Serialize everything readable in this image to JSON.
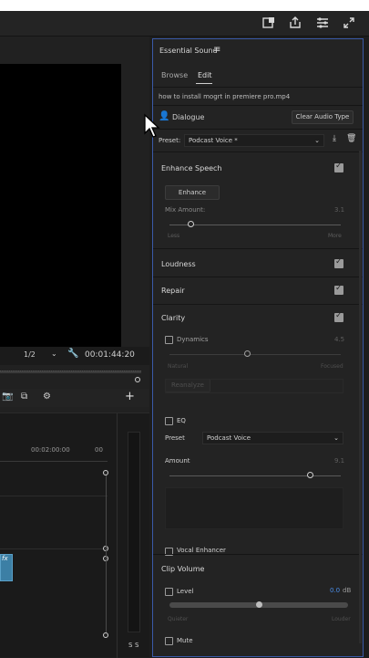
{
  "essential_sound": {
    "title": "Essential Sound",
    "menu_icon": "hamburger-icon",
    "tabs": [
      {
        "label": "Browse"
      },
      {
        "label": "Edit"
      }
    ],
    "clip_name": "how to install mogrt in premiere pro.mp4",
    "audio_type": "Dialogue",
    "clear_label": "Clear Audio Type",
    "preset_label": "Preset:",
    "preset_value": "Podcast Voice *",
    "enhance_speech": {
      "title": "Enhance Speech",
      "button": "Enhance",
      "mix_label": "Mix Amount:",
      "mix_value": "3.1",
      "left": "Less",
      "right": "More",
      "mix_level": 0.12
    },
    "loudness": {
      "title": "Loudness"
    },
    "repair": {
      "title": "Repair"
    },
    "clarity": {
      "title": "Clarity",
      "dynamics": {
        "label": "Dynamics",
        "value": "4.5",
        "left": "Natural",
        "right": "Focused",
        "button": "Reanalyze",
        "level": 0.45
      },
      "eq": {
        "label": "EQ",
        "preset_label": "Preset",
        "preset_value": "Podcast Voice",
        "amount_label": "Amount",
        "amount_value": "9.1",
        "level": 0.82
      },
      "vocal_enhancer": {
        "label": "Vocal Enhancer"
      }
    },
    "clip_volume": {
      "title": "Clip Volume",
      "level_label": "Level",
      "level_value": "0.0",
      "level_unit": "dB",
      "left": "Quieter",
      "right": "Louder",
      "level": 0.5,
      "mute_label": "Mute"
    }
  },
  "monitor": {
    "zoom": "1/2",
    "timecode": "00:01:44:20"
  },
  "timeline": {
    "ruler_time": "00:02:00:00",
    "ruler_time2": "00",
    "meter_labels": [
      "S",
      "S"
    ],
    "fx_badge": "fx"
  },
  "colors": {
    "accent": "#3a5aa8",
    "value_blue": "#4a8de8"
  }
}
